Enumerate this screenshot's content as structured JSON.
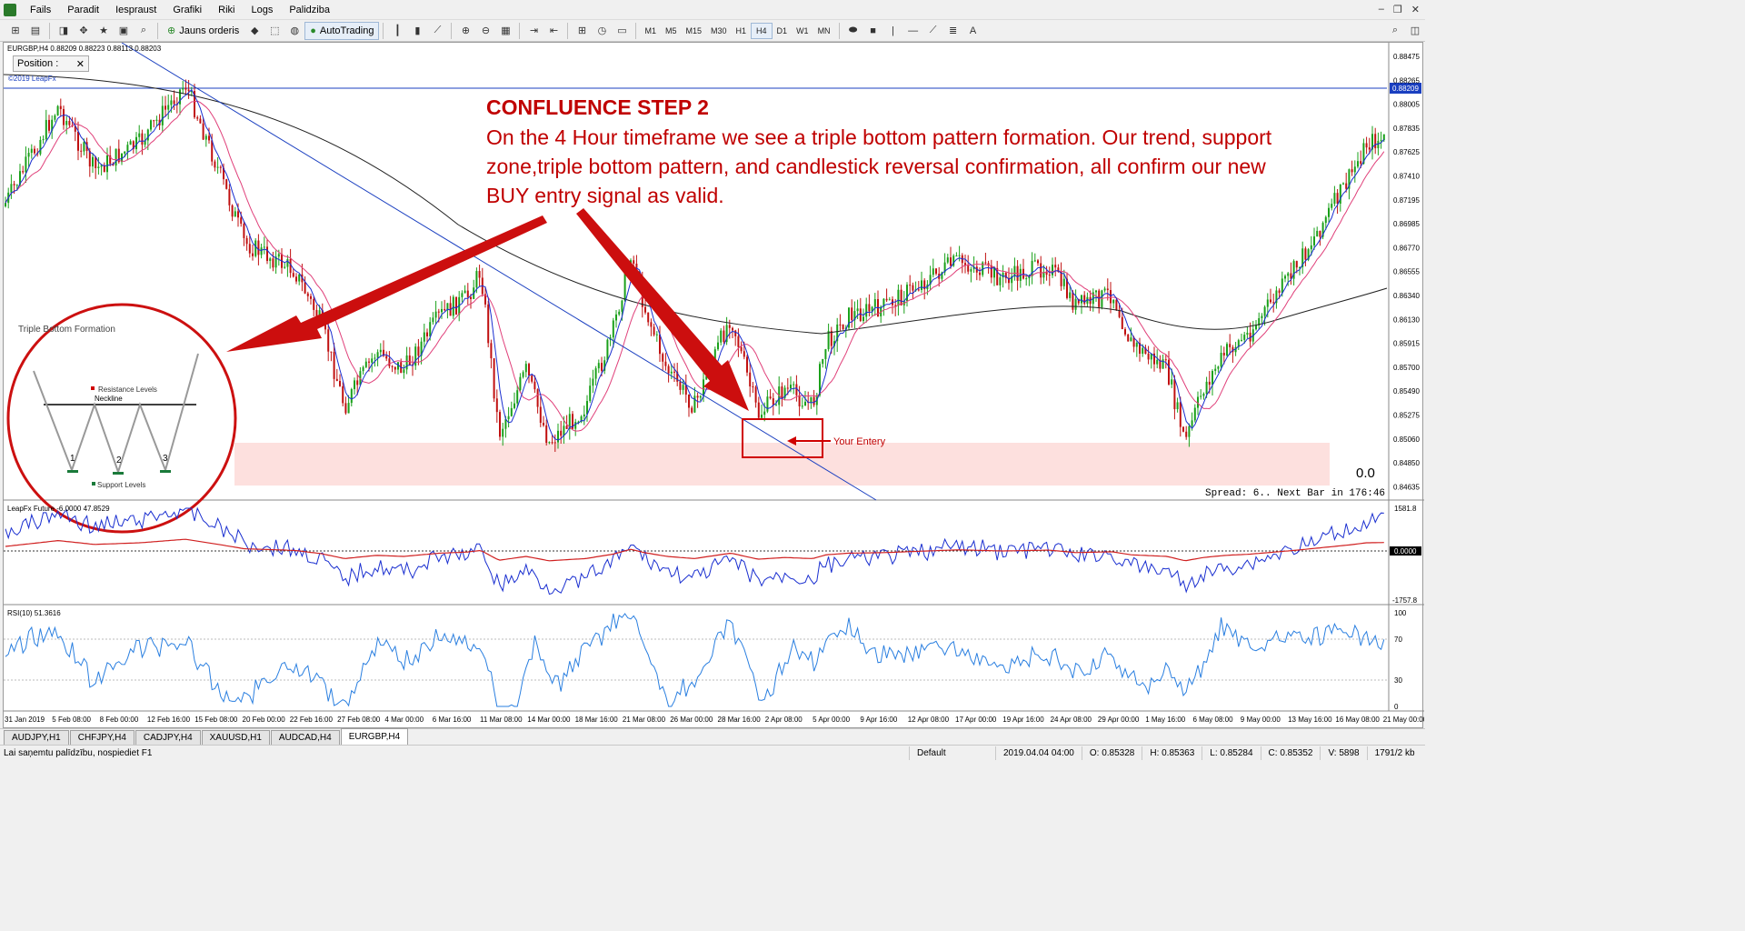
{
  "menu": [
    "Fails",
    "Paradit",
    "Iespraust",
    "Grafiki",
    "Riki",
    "Logs",
    "Palidziba"
  ],
  "toolbar": {
    "new_order": "Jauns orderis",
    "autotrading": "AutoTrading",
    "timeframes": [
      "M1",
      "M5",
      "M15",
      "M30",
      "H1",
      "H4",
      "D1",
      "W1",
      "MN"
    ],
    "active_timeframe": "H4",
    "text_tool": "A"
  },
  "chart": {
    "info": "EURGBP,H4  0.88209 0.88223 0.88113 0.88203",
    "position_window": "Position :",
    "copyright": "©2019 LeapFx",
    "current_price": "0.88209",
    "price_labels": [
      "0.88475",
      "0.88265",
      "0.88005",
      "0.87835",
      "0.87625",
      "0.87410",
      "0.87195",
      "0.86985",
      "0.86770",
      "0.86555",
      "0.86340",
      "0.86130",
      "0.85915",
      "0.85700",
      "0.85490",
      "0.85275",
      "0.85060",
      "0.84850",
      "0.84635"
    ],
    "spread_text": "Spread: 6.. Next Bar in 176:46",
    "zero_value": "0.0",
    "entry_label": "Your Entery",
    "triple_bottom": {
      "title": "Triple Bottom Formation",
      "resistance": "Resistance Levels",
      "neckline": "Neckline",
      "support": "Support Levels",
      "bottoms": [
        "1",
        "2",
        "3"
      ]
    }
  },
  "annotation": {
    "title": "CONFLUENCE STEP 2",
    "body": "On the 4 Hour timeframe we see a triple bottom pattern formation.  Our trend, support zone,triple bottom pattern, and candlestick reversal confirmation, all confirm our new BUY entry signal as valid."
  },
  "indicator1": {
    "label": "LeapFx Future -6.0000 47.8529",
    "levels": [
      "1581.8",
      "0.0000",
      "-1757.8"
    ]
  },
  "indicator2": {
    "label": "RSI(10) 51.3616",
    "levels": [
      "100",
      "70",
      "30",
      "0"
    ]
  },
  "time_axis": [
    "31 Jan 2019",
    "5 Feb 08:00",
    "8 Feb 00:00",
    "12 Feb 16:00",
    "15 Feb 08:00",
    "20 Feb 00:00",
    "22 Feb 16:00",
    "27 Feb 08:00",
    "4 Mar 00:00",
    "6 Mar 16:00",
    "11 Mar 08:00",
    "14 Mar 00:00",
    "18 Mar 16:00",
    "21 Mar 08:00",
    "26 Mar 00:00",
    "28 Mar 16:00",
    "2 Apr 08:00",
    "5 Apr 00:00",
    "9 Apr 16:00",
    "12 Apr 08:00",
    "17 Apr 00:00",
    "19 Apr 16:00",
    "24 Apr 08:00",
    "29 Apr 00:00",
    "1 May 16:00",
    "6 May 08:00",
    "9 May 00:00",
    "13 May 16:00",
    "16 May 08:00",
    "21 May 00:00"
  ],
  "tabs": [
    "AUDJPY,H1",
    "CHFJPY,H4",
    "CADJPY,H4",
    "XAUUSD,H1",
    "AUDCAD,H4",
    "EURGBP,H4"
  ],
  "active_tab": "EURGBP,H4",
  "status": {
    "help": "Lai saņemtu palīdzību, nospiediet F1",
    "profile": "Default",
    "datetime": "2019.04.04 04:00",
    "open": "O: 0.85328",
    "high": "H: 0.85363",
    "low": "L: 0.85284",
    "close": "C: 0.85352",
    "volume": "V: 5898",
    "traffic": "1791/2 kb"
  },
  "colors": {
    "annotation": "#c00000",
    "support_zone": "#fde0de",
    "trendline": "#1a3fc0",
    "bull": "#1aa01a",
    "bear": "#c01010"
  }
}
